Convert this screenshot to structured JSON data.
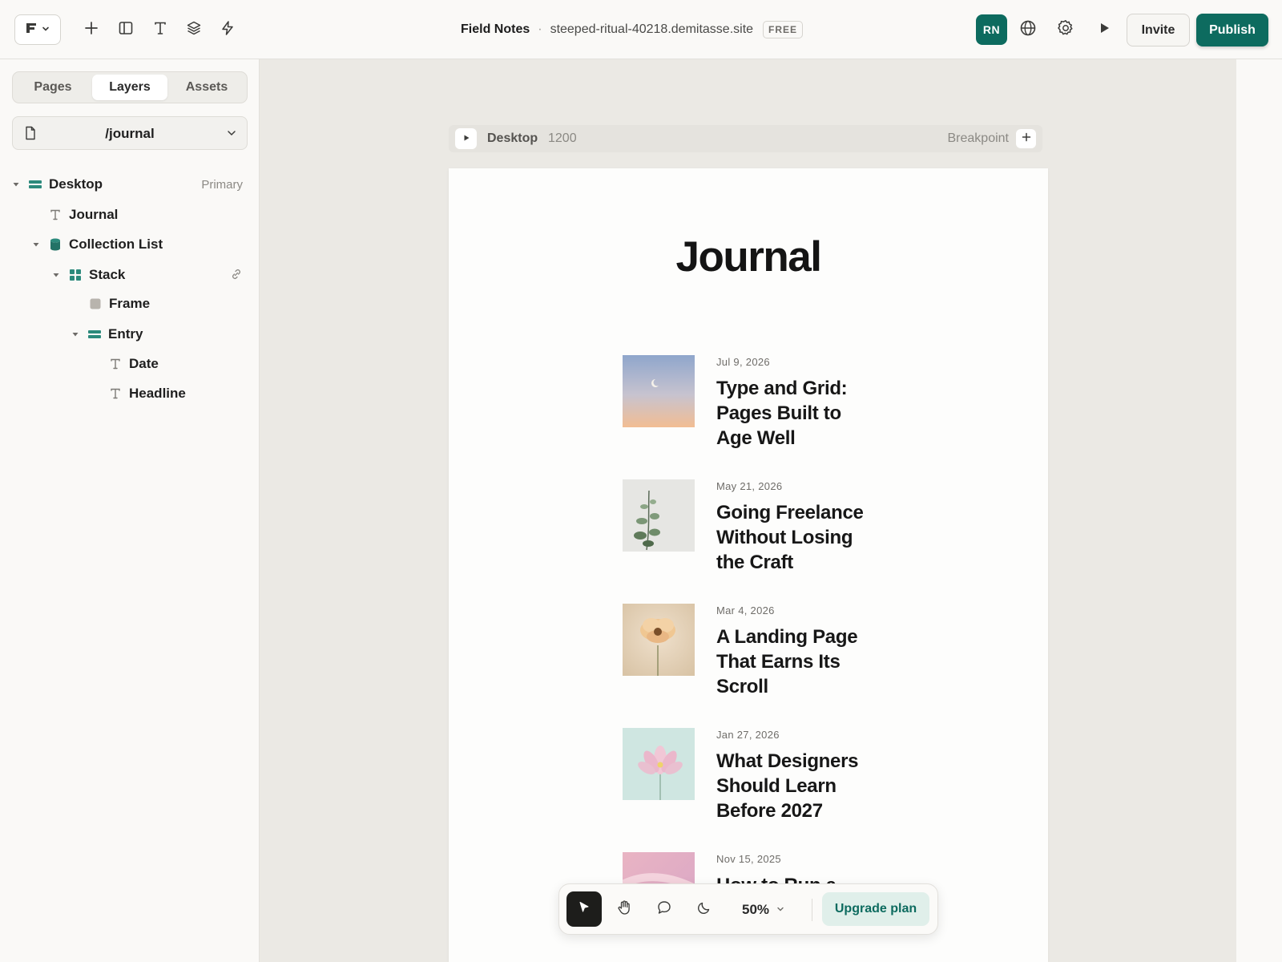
{
  "topbar": {
    "project_title": "Field Notes",
    "separator": "·",
    "domain": "steeped-ritual-40218.demitasse.site",
    "plan_badge": "FREE",
    "avatar_initials": "RN",
    "invite_label": "Invite",
    "publish_label": "Publish",
    "tools": [
      "add-icon",
      "layout-icon",
      "text-icon",
      "layers-icon",
      "bolt-icon"
    ],
    "right_icons": [
      "globe-icon",
      "gear-icon",
      "play-icon"
    ]
  },
  "sidebar": {
    "tabs": [
      {
        "label": "Pages",
        "active": false
      },
      {
        "label": "Layers",
        "active": true
      },
      {
        "label": "Assets",
        "active": false
      }
    ],
    "current_page": "/journal",
    "layers": [
      {
        "label": "Desktop",
        "type": "frame",
        "tag": "Primary"
      },
      {
        "label": "Journal",
        "type": "text"
      },
      {
        "label": "Collection List",
        "type": "collection"
      },
      {
        "label": "Stack",
        "type": "stack"
      },
      {
        "label": "Frame",
        "type": "frame-fill"
      },
      {
        "label": "Entry",
        "type": "frame"
      },
      {
        "label": "Date",
        "type": "text"
      },
      {
        "label": "Headline",
        "type": "text"
      }
    ]
  },
  "canvas": {
    "breakpoint_name": "Desktop",
    "breakpoint_width": "1200",
    "breakpoint_label": "Breakpoint",
    "page_title": "Journal",
    "entries": [
      {
        "date": "Jul 9, 2026",
        "headline": "Type and Grid: Pages Built to Age Well",
        "thumb": "sky-moon"
      },
      {
        "date": "May 21, 2026",
        "headline": "Going Freelance Without Losing the Craft",
        "thumb": "eucalyptus"
      },
      {
        "date": "Mar 4, 2026",
        "headline": "A Landing Page That Earns Its Scroll",
        "thumb": "peach-flower"
      },
      {
        "date": "Jan 27, 2026",
        "headline": "What Designers Should Learn Before 2027",
        "thumb": "lotus"
      },
      {
        "date": "Nov 15, 2025",
        "headline": "How to Run a ... That Sticks",
        "thumb": "pink-abstract"
      }
    ]
  },
  "floating_toolbar": {
    "tools": [
      "cursor-icon",
      "hand-icon",
      "comment-icon",
      "moon-icon"
    ],
    "zoom": "50%",
    "upgrade_label": "Upgrade plan"
  },
  "colors": {
    "accent": "#0d6b5f",
    "canvas_bg": "#ebe9e4",
    "panel_bg": "#faf9f7"
  }
}
